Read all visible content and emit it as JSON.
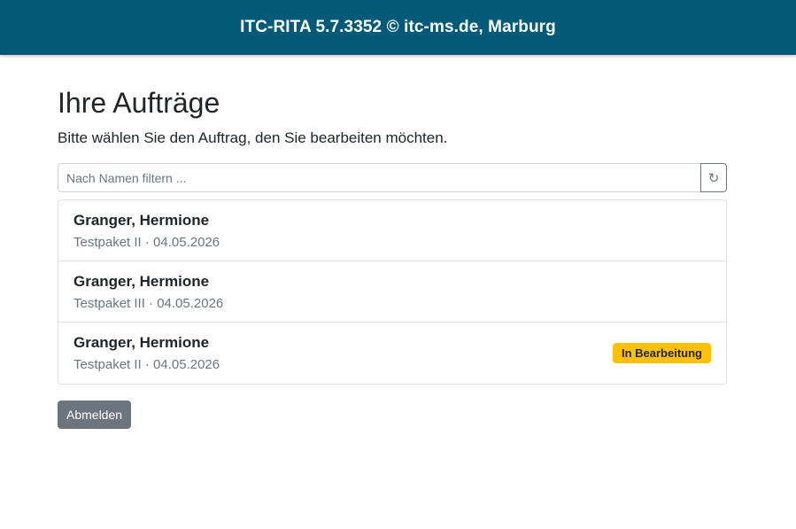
{
  "header": {
    "title": "ITC-RITA 5.7.3352 © itc-ms.de, Marburg",
    "background": "#035a78"
  },
  "main": {
    "title": "Ihre Aufträge",
    "subtitle": "Bitte wählen Sie den Auftrag, den Sie bearbeiten möchten."
  },
  "filter": {
    "value": "",
    "placeholder": "Nach Namen filtern ...",
    "refresh_icon": "refresh-icon",
    "refresh_glyph": "↻"
  },
  "orders": [
    {
      "name": "Granger, Hermione",
      "meta": "Testpaket II · 04.05.2026",
      "status": ""
    },
    {
      "name": "Granger, Hermione",
      "meta": "Testpaket III · 04.05.2026",
      "status": ""
    },
    {
      "name": "Granger, Hermione",
      "meta": "Testpaket II · 04.05.2026",
      "status": "In Bearbeitung"
    }
  ],
  "status_color": "#ffc107",
  "logout": {
    "label": "Abmelden"
  }
}
